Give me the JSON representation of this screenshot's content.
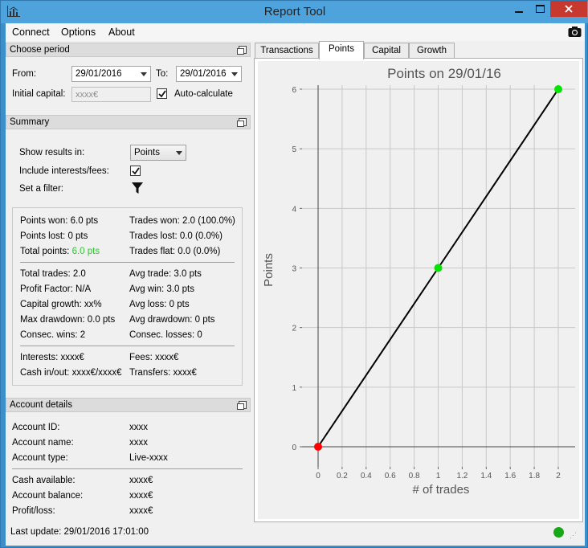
{
  "window": {
    "title": "Report Tool"
  },
  "menu": {
    "items": [
      "Connect",
      "Options",
      "About"
    ]
  },
  "choose_period": {
    "title": "Choose period",
    "from_label": "From:",
    "from_value": "29/01/2016",
    "to_label": "To:",
    "to_value": "29/01/2016",
    "capital_label": "Initial capital:",
    "capital_placeholder": "xxxx€",
    "auto_label": "Auto-calculate",
    "auto_checked": true
  },
  "summary": {
    "title": "Summary",
    "show_results_label": "Show results in:",
    "show_results_value": "Points",
    "include_label": "Include interests/fees:",
    "include_checked": true,
    "filter_label": "Set a filter:",
    "points_won": "Points won: 6.0 pts",
    "trades_won": "Trades won: 2.0 (100.0%)",
    "points_lost": "Points lost: 0 pts",
    "trades_lost": "Trades lost: 0.0 (0.0%)",
    "total_points_label": "Total points:",
    "total_points_value": "6.0 pts",
    "trades_flat": "Trades flat: 0.0 (0.0%)",
    "total_trades": "Total trades: 2.0",
    "avg_trade": "Avg trade: 3.0 pts",
    "profit_factor": "Profit Factor: N/A",
    "avg_win": "Avg win: 3.0 pts",
    "capital_growth": "Capital growth: xx%",
    "avg_loss": "Avg loss: 0 pts",
    "max_drawdown": "Max drawdown: 0.0 pts",
    "avg_drawdown": "Avg drawdown: 0 pts",
    "consec_wins": "Consec. wins: 2",
    "consec_losses": "Consec. losses: 0",
    "interests": "Interests: xxxx€",
    "fees": "Fees: xxxx€",
    "cash_in_out": "Cash in/out: xxxx€/xxxx€",
    "transfers": "Transfers: xxxx€"
  },
  "account": {
    "title": "Account details",
    "rows": [
      {
        "label": "Account ID:",
        "value": "xxxx"
      },
      {
        "label": "Account name:",
        "value": "xxxx"
      },
      {
        "label": "Account type:",
        "value": "Live-xxxx"
      },
      {
        "label": "Cash available:",
        "value": "xxxx€"
      },
      {
        "label": "Account balance:",
        "value": "xxxx€"
      },
      {
        "label": "Profit/loss:",
        "value": "xxxx€"
      }
    ]
  },
  "status": {
    "last_update": "Last update: 29/01/2016 17:01:00",
    "connection_color": "#17a817"
  },
  "tabs": [
    "Transactions",
    "Points",
    "Capital",
    "Growth"
  ],
  "active_tab": "Points",
  "chart_data": {
    "type": "line",
    "title": "Points on 29/01/16",
    "xlabel": "# of trades",
    "ylabel": "Points",
    "x": [
      0,
      1,
      2
    ],
    "y": [
      0,
      3,
      6
    ],
    "point_colors": [
      "#ff0000",
      "#00e600",
      "#00e600"
    ],
    "xlim": [
      0,
      2
    ],
    "ylim": [
      0,
      6
    ],
    "xticks": [
      "0",
      "0.2",
      "0.4",
      "0.6",
      "0.8",
      "1",
      "1.2",
      "1.4",
      "1.6",
      "1.8",
      "2"
    ],
    "yticks": [
      "0",
      "1",
      "2",
      "3",
      "4",
      "5",
      "6"
    ],
    "grid": true,
    "line_color": "#000000"
  }
}
